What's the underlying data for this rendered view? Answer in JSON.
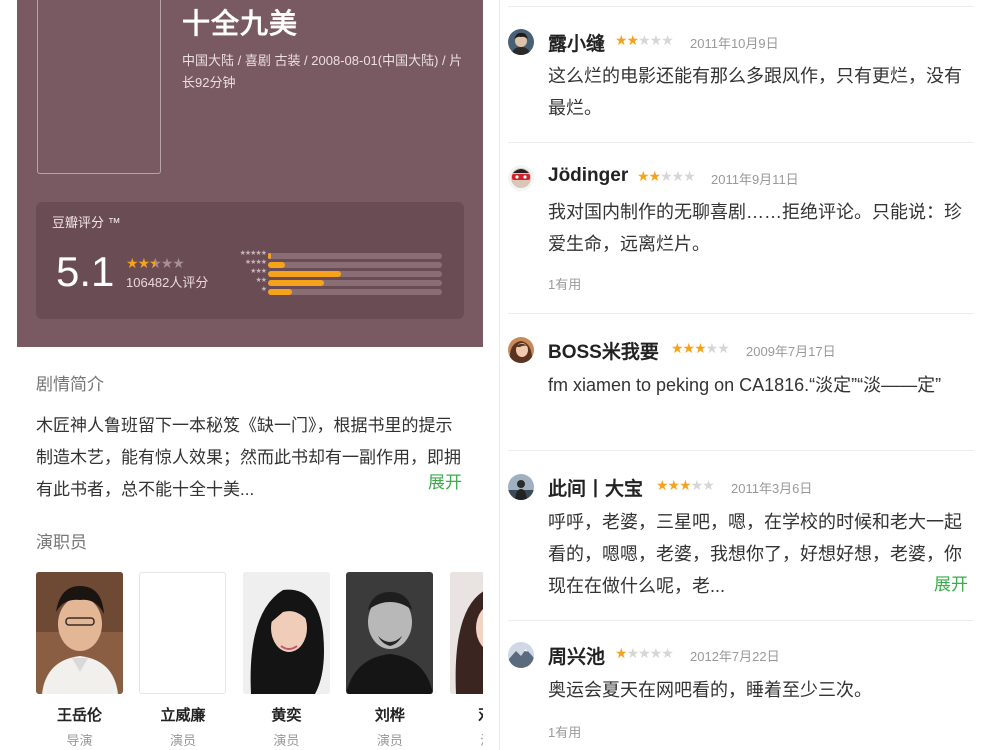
{
  "movie": {
    "title": "十全九美",
    "meta": "中国大陆 / 喜剧 古装 / 2008-08-01(中国大陆) / 片长92分钟",
    "rating_label": "豆瓣评分 ™",
    "score": "5.1",
    "stars": 2.5,
    "rating_count": "106482人评分",
    "distribution": [
      {
        "stars": "★★★★★",
        "fraction": 0.02
      },
      {
        "stars": "★★★★",
        "fraction": 0.1
      },
      {
        "stars": "★★★",
        "fraction": 0.42
      },
      {
        "stars": "★★",
        "fraction": 0.32
      },
      {
        "stars": "★",
        "fraction": 0.14
      }
    ],
    "header_color": "#7a5a62"
  },
  "synopsis": {
    "title": "剧情简介",
    "text": "木匠神人鲁班留下一本秘笈《缺一门》，根据书里的提示制造木艺，能有惊人效果；然而此书却有一副作用，即拥有此书者，总不能十全十美...",
    "expand": "展开"
  },
  "cast": {
    "title": "演职员",
    "members": [
      {
        "name": "王岳伦",
        "role": "导演"
      },
      {
        "name": "立威廉",
        "role": "演员"
      },
      {
        "name": "黄奕",
        "role": "演员"
      },
      {
        "name": "刘桦",
        "role": "演员"
      },
      {
        "name": "邓家",
        "role": "演员"
      }
    ]
  },
  "reviews": [
    {
      "user": "露小缝",
      "stars": 2,
      "date": "2011年10月9日",
      "text": "这么烂的电影还能有那么多跟风作，只有更烂，没有最烂。",
      "useful": "",
      "expand": ""
    },
    {
      "user": "Jödinger",
      "stars": 2,
      "date": "2011年9月11日",
      "text": "我对国内制作的无聊喜剧……拒绝评论。只能说：珍爱生命，远离烂片。",
      "useful": "1有用",
      "expand": ""
    },
    {
      "user": "BOSS米我要",
      "stars": 3,
      "date": "2009年7月17日",
      "text": "fm xiamen to peking on CA1816.“淡定”“淡——定”",
      "useful": "",
      "expand": ""
    },
    {
      "user": "此间丨大宝",
      "stars": 3,
      "date": "2011年3月6日",
      "text": "呼呼，老婆，三星吧，嗯，在学校的时候和老大一起看的，嗯嗯，老婆，我想你了，好想好想，老婆，你现在在做什么呢，老...",
      "useful": "",
      "expand": "展开"
    },
    {
      "user": "周兴池",
      "stars": 1,
      "date": "2012年7月22日",
      "text": "奥运会夏天在网吧看的，睡着至少三次。",
      "useful": "1有用",
      "expand": ""
    }
  ],
  "colors": {
    "accent_green": "#3bab4c",
    "star": "#f7a21b"
  }
}
